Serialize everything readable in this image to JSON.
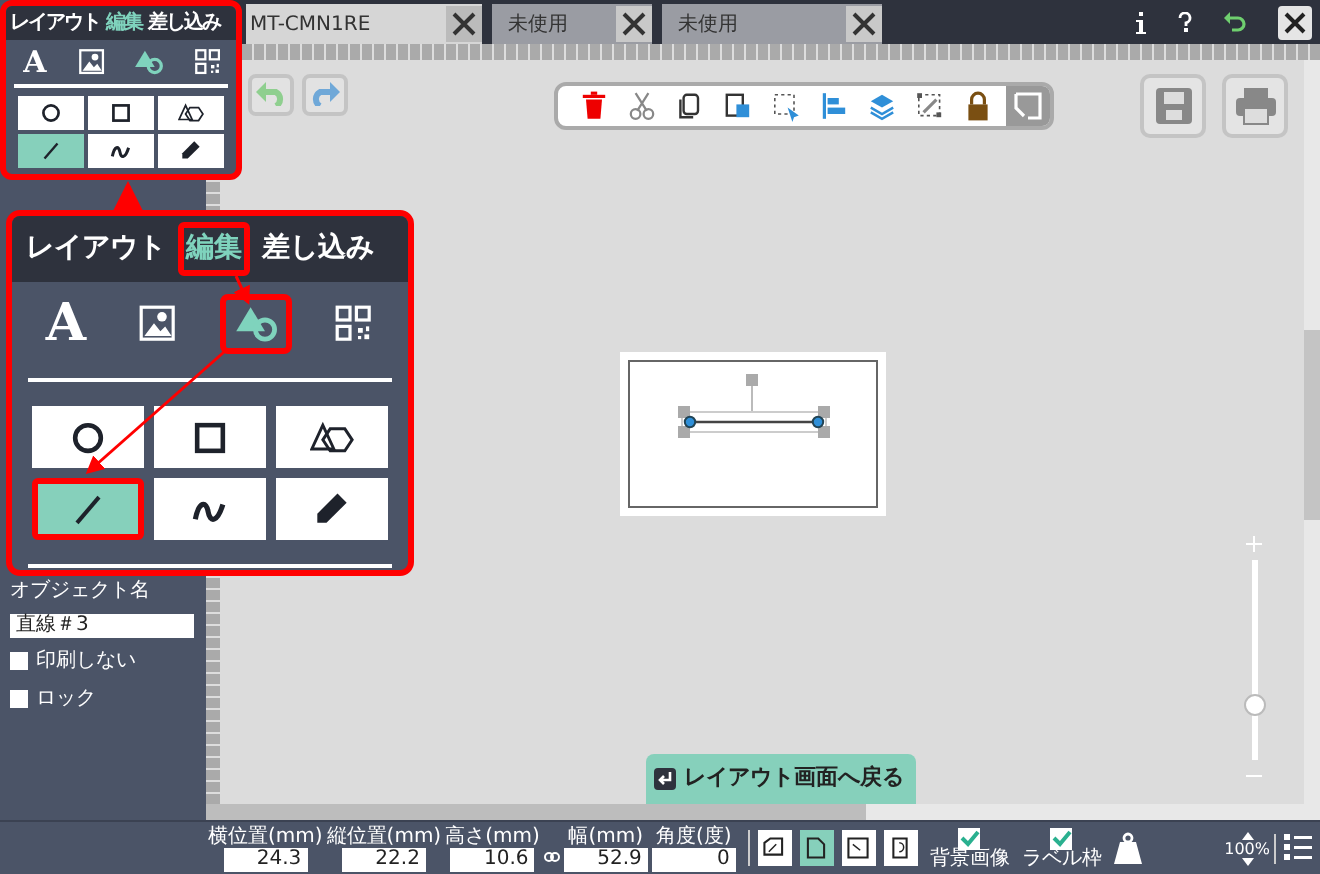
{
  "tabs": [
    {
      "label": "MT-CMN1RE",
      "selected": true
    },
    {
      "label": "未使用",
      "selected": false
    },
    {
      "label": "未使用",
      "selected": false
    }
  ],
  "mini_panel": {
    "modes": [
      {
        "label": "レイアウト",
        "selected": false
      },
      {
        "label": "編集",
        "selected": true
      },
      {
        "label": "差し込み",
        "selected": false
      }
    ],
    "categories": [
      {
        "kind": "text",
        "glyph": "A",
        "selected": false
      },
      {
        "kind": "image",
        "selected": false
      },
      {
        "kind": "shape",
        "selected": true
      },
      {
        "kind": "qr",
        "selected": false
      }
    ],
    "shapes": [
      {
        "kind": "circle",
        "selected": false
      },
      {
        "kind": "square",
        "selected": false
      },
      {
        "kind": "polygon",
        "selected": false
      },
      {
        "kind": "line",
        "selected": true
      },
      {
        "kind": "curve",
        "selected": false
      },
      {
        "kind": "pencil",
        "selected": false
      }
    ]
  },
  "callout_panel": {
    "modes": [
      {
        "label": "レイアウト",
        "selected": false
      },
      {
        "label": "編集",
        "selected": true
      },
      {
        "label": "差し込み",
        "selected": false
      }
    ],
    "categories": [
      {
        "kind": "text",
        "glyph": "A",
        "selected": false
      },
      {
        "kind": "image",
        "selected": false
      },
      {
        "kind": "shape",
        "selected": true
      },
      {
        "kind": "qr",
        "selected": false
      }
    ],
    "shapes": [
      {
        "kind": "circle",
        "selected": false
      },
      {
        "kind": "square",
        "selected": false
      },
      {
        "kind": "polygon",
        "selected": false
      },
      {
        "kind": "line",
        "selected": true
      },
      {
        "kind": "curve",
        "selected": false
      },
      {
        "kind": "pencil",
        "selected": false
      }
    ]
  },
  "object_name": {
    "label": "オブジェクト名",
    "value": "直線＃3"
  },
  "options": [
    {
      "label": "印刷しない",
      "checked": false
    },
    {
      "label": "ロック",
      "checked": false
    }
  ],
  "return_button": "レイアウト画面へ戻る",
  "zoom": {
    "level": 0.27,
    "reading": "100%"
  },
  "fields": [
    {
      "label": "横位置(mm)",
      "value": "24.3"
    },
    {
      "label": "縦位置(mm)",
      "value": "22.2"
    },
    {
      "label": "高さ(mm)",
      "value": "10.6"
    },
    {
      "label": "幅(mm)",
      "value": "52.9"
    },
    {
      "label": "角度(度)",
      "value": "0"
    }
  ],
  "placement_buttons": [
    {
      "selected": false
    },
    {
      "selected": true
    },
    {
      "selected": false
    },
    {
      "selected": false
    }
  ],
  "toggles": [
    {
      "label": "背景画像",
      "checked": true
    },
    {
      "label": "ラベル枠",
      "checked": true
    }
  ]
}
